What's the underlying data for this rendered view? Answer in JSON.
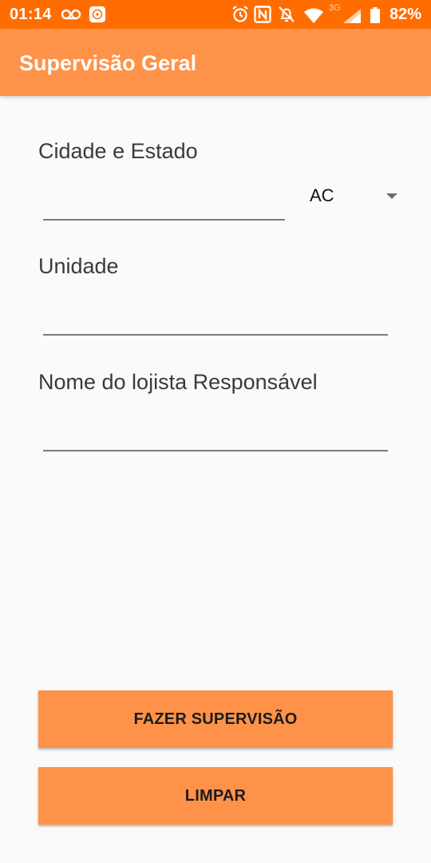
{
  "status_bar": {
    "time": "01:14",
    "network": "3G",
    "battery": "82%",
    "color": "#ff6d00",
    "icons": [
      "voicemail-icon",
      "app-notification-icon",
      "alarm-icon",
      "nfc-icon",
      "mute-icon",
      "wifi-icon",
      "signal-icon",
      "battery-icon"
    ]
  },
  "app_bar": {
    "title": "Supervisão Geral",
    "color": "#ff9249"
  },
  "form": {
    "city_state_label": "Cidade e Estado",
    "city_value": "",
    "state_value": "AC",
    "unit_label": "Unidade",
    "unit_value": "",
    "manager_label": "Nome do lojista Responsável",
    "manager_value": ""
  },
  "buttons": {
    "supervise": "FAZER SUPERVISÃO",
    "clear": "LIMPAR"
  }
}
